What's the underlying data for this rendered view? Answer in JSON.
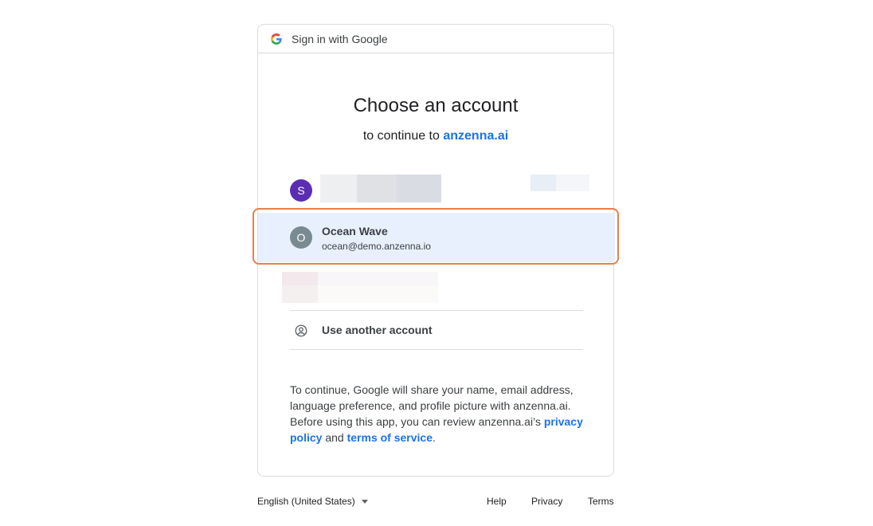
{
  "header": {
    "title": "Sign in with Google"
  },
  "main": {
    "title": "Choose an account",
    "subtitle_prefix": "to continue to",
    "app_name": "anzenna.ai"
  },
  "accounts": [
    {
      "initial": "S",
      "color": "#5b2db3",
      "redacted": true
    },
    {
      "initial": "O",
      "color": "#7a8a91",
      "name": "Ocean Wave",
      "email": "ocean@demo.anzenna.io",
      "selected": true
    },
    {
      "redacted": true
    }
  ],
  "use_another": {
    "label": "Use another account"
  },
  "disclosure": {
    "text_1": "To continue, Google will share your name, email address, language preference, and profile picture with anzenna.ai. Before using this app, you can review anzenna.ai’s",
    "privacy_policy": "privacy policy",
    "and": "and",
    "terms_of_service": "terms of service",
    "end": "."
  },
  "footer": {
    "language": "English (United States)",
    "help": "Help",
    "privacy": "Privacy",
    "terms": "Terms"
  },
  "colors": {
    "accent": "#1a73e8",
    "selected_bg": "#e8f0fe",
    "highlight": "#e8804a"
  }
}
